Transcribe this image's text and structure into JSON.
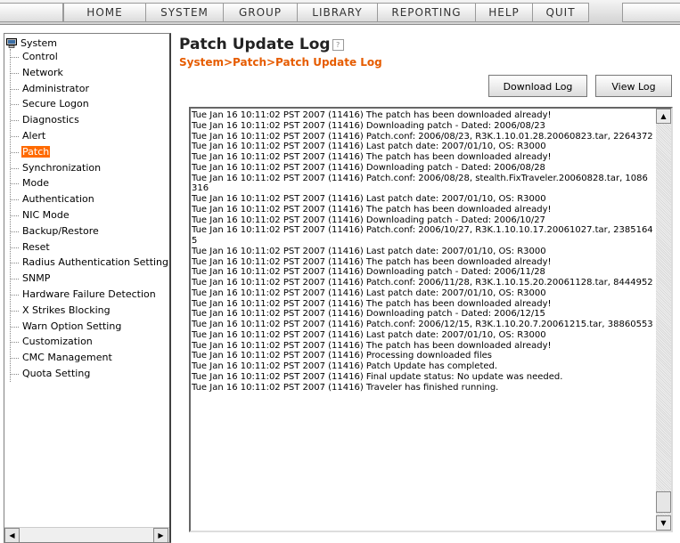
{
  "topnav": {
    "items": [
      "HOME",
      "SYSTEM",
      "GROUP",
      "LIBRARY",
      "REPORTING",
      "HELP",
      "QUIT"
    ]
  },
  "sidebar": {
    "root": "System",
    "items": [
      "Control",
      "Network",
      "Administrator",
      "Secure Logon",
      "Diagnostics",
      "Alert",
      "Patch",
      "Synchronization",
      "Mode",
      "Authentication",
      "NIC Mode",
      "Backup/Restore",
      "Reset",
      "Radius Authentication Setting",
      "SNMP",
      "Hardware Failure Detection",
      "X Strikes Blocking",
      "Warn Option Setting",
      "Customization",
      "CMC Management",
      "Quota Setting"
    ],
    "selected_index": 6
  },
  "page": {
    "title": "Patch Update Log",
    "breadcrumb": "System>Patch>Patch Update Log"
  },
  "buttons": {
    "download": "Download Log",
    "view": "View Log"
  },
  "log": {
    "text": "Tue Jan 16 10:11:02 PST 2007 (11416) The patch has been downloaded already!\nTue Jan 16 10:11:02 PST 2007 (11416) Downloading patch - Dated: 2006/08/23\nTue Jan 16 10:11:02 PST 2007 (11416) Patch.conf: 2006/08/23, R3K.1.10.01.28.20060823.tar, 2264372\nTue Jan 16 10:11:02 PST 2007 (11416) Last patch date: 2007/01/10, OS: R3000\nTue Jan 16 10:11:02 PST 2007 (11416) The patch has been downloaded already!\nTue Jan 16 10:11:02 PST 2007 (11416) Downloading patch - Dated: 2006/08/28\nTue Jan 16 10:11:02 PST 2007 (11416) Patch.conf: 2006/08/28, stealth.FixTraveler.20060828.tar, 1086316\nTue Jan 16 10:11:02 PST 2007 (11416) Last patch date: 2007/01/10, OS: R3000\nTue Jan 16 10:11:02 PST 2007 (11416) The patch has been downloaded already!\nTue Jan 16 10:11:02 PST 2007 (11416) Downloading patch - Dated: 2006/10/27\nTue Jan 16 10:11:02 PST 2007 (11416) Patch.conf: 2006/10/27, R3K.1.10.10.17.20061027.tar, 23851645\nTue Jan 16 10:11:02 PST 2007 (11416) Last patch date: 2007/01/10, OS: R3000\nTue Jan 16 10:11:02 PST 2007 (11416) The patch has been downloaded already!\nTue Jan 16 10:11:02 PST 2007 (11416) Downloading patch - Dated: 2006/11/28\nTue Jan 16 10:11:02 PST 2007 (11416) Patch.conf: 2006/11/28, R3K.1.10.15.20.20061128.tar, 8444952\nTue Jan 16 10:11:02 PST 2007 (11416) Last patch date: 2007/01/10, OS: R3000\nTue Jan 16 10:11:02 PST 2007 (11416) The patch has been downloaded already!\nTue Jan 16 10:11:02 PST 2007 (11416) Downloading patch - Dated: 2006/12/15\nTue Jan 16 10:11:02 PST 2007 (11416) Patch.conf: 2006/12/15, R3K.1.10.20.7.20061215.tar, 38860553\nTue Jan 16 10:11:02 PST 2007 (11416) Last patch date: 2007/01/10, OS: R3000\nTue Jan 16 10:11:02 PST 2007 (11416) The patch has been downloaded already!\nTue Jan 16 10:11:02 PST 2007 (11416) Processing downloaded files\nTue Jan 16 10:11:02 PST 2007 (11416) Patch Update has completed.\nTue Jan 16 10:11:02 PST 2007 (11416) Final update status: No update was needed.\nTue Jan 16 10:11:02 PST 2007 (11416) Traveler has finished running."
  },
  "colors": {
    "accent": "#ff6a00",
    "breadcrumb": "#e65c00"
  }
}
